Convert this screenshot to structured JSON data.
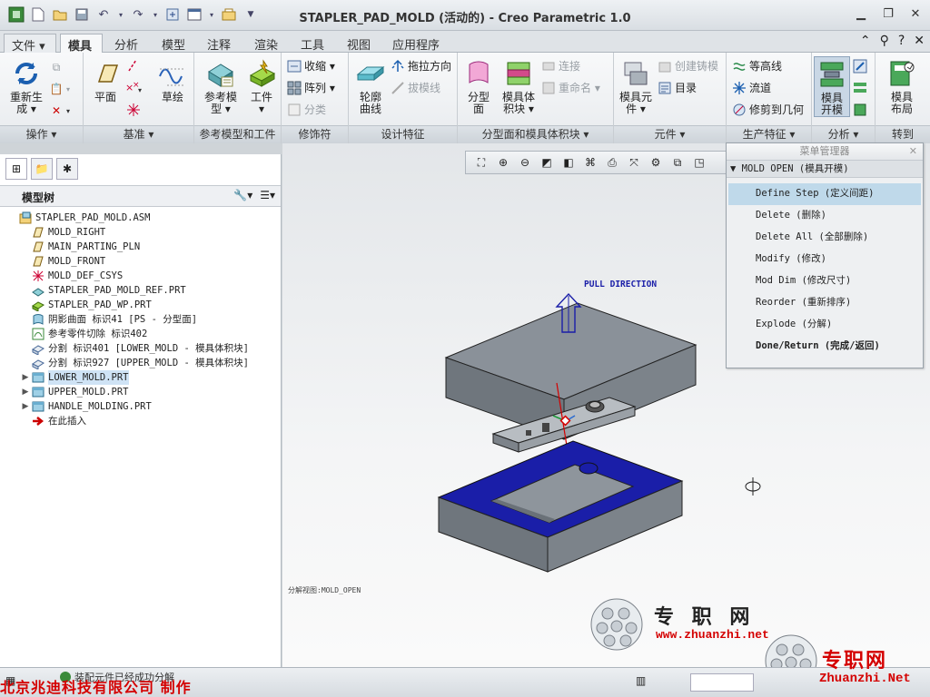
{
  "window": {
    "title": "STAPLER_PAD_MOLD (活动的) - Creo Parametric 1.0"
  },
  "tabs": [
    {
      "label": "文件 ▾"
    },
    {
      "label": "模具"
    },
    {
      "label": "分析"
    },
    {
      "label": "模型"
    },
    {
      "label": "注释"
    },
    {
      "label": "渲染"
    },
    {
      "label": "工具"
    },
    {
      "label": "视图"
    },
    {
      "label": "应用程序"
    }
  ],
  "ribbon": {
    "operations": {
      "label": "操作 ▾",
      "regen": "重新生\n成 ▾"
    },
    "datum": {
      "label": "基准 ▾",
      "plane": "平面",
      "sketch": "草绘"
    },
    "ref": {
      "label": "参考模型和工件",
      "refmodel": "参考模\n型 ▾",
      "workpiece": "工件\n▾"
    },
    "deco": {
      "label": "修饰符",
      "shrink": "收缩 ▾",
      "pattern": "阵列 ▾",
      "classify": "分类"
    },
    "design": {
      "label": "设计特征",
      "silhouette": "轮廓\n曲线",
      "pulldir": "拖拉方向",
      "draftline": "拔模线"
    },
    "parting": {
      "label": "分型面和模具体积块 ▾",
      "partingsurf": "分型\n面",
      "moldvol": "模具体\n积块 ▾",
      "connect": "连接",
      "rename": "重命名 ▾"
    },
    "component": {
      "label": "元件 ▾",
      "moldcomp": "模具元\n件 ▾",
      "createcast": "创建铸模",
      "catalog": "目录"
    },
    "production": {
      "label": "生产特征 ▾",
      "contour": "等高线",
      "runner": "流道",
      "trim": "修剪到几何"
    },
    "analysis": {
      "label": "分析 ▾",
      "moldopen": "模具\n开模"
    },
    "goto": {
      "label": "转到",
      "layout": "模具\n布局"
    }
  },
  "modeltree": {
    "title": "模型树",
    "items": [
      {
        "label": "STAPLER_PAD_MOLD.ASM",
        "icon": "assembly-icon",
        "expand": "",
        "indent": 0
      },
      {
        "label": "MOLD_RIGHT",
        "icon": "datum-plane-icon",
        "expand": "",
        "indent": 1
      },
      {
        "label": "MAIN_PARTING_PLN",
        "icon": "datum-plane-icon",
        "expand": "",
        "indent": 1
      },
      {
        "label": "MOLD_FRONT",
        "icon": "datum-plane-icon",
        "expand": "",
        "indent": 1
      },
      {
        "label": "MOLD_DEF_CSYS",
        "icon": "csys-icon",
        "expand": "",
        "indent": 1
      },
      {
        "label": "STAPLER_PAD_MOLD_REF.PRT",
        "icon": "ref-part-icon",
        "expand": "",
        "indent": 1
      },
      {
        "label": "STAPLER_PAD_WP.PRT",
        "icon": "workpiece-icon",
        "expand": "",
        "indent": 1
      },
      {
        "label": "阴影曲面 标识41 [PS - 分型面]",
        "icon": "surface-icon",
        "expand": "",
        "indent": 1
      },
      {
        "label": "参考零件切除 标识402",
        "icon": "cut-icon",
        "expand": "",
        "indent": 1
      },
      {
        "label": "分割 标识401 [LOWER_MOLD - 模具体积块]",
        "icon": "split-icon",
        "expand": "",
        "indent": 1
      },
      {
        "label": "分割 标识927 [UPPER_MOLD - 模具体积块]",
        "icon": "split-icon",
        "expand": "",
        "indent": 1
      },
      {
        "label": "LOWER_MOLD.PRT",
        "icon": "part-icon",
        "expand": "▶",
        "indent": 1,
        "selected": true
      },
      {
        "label": "UPPER_MOLD.PRT",
        "icon": "part-icon",
        "expand": "▶",
        "indent": 1
      },
      {
        "label": "HANDLE_MOLDING.PRT",
        "icon": "part-icon",
        "expand": "▶",
        "indent": 1
      },
      {
        "label": "在此插入",
        "icon": "insert-arrow-icon",
        "expand": "",
        "indent": 1
      }
    ]
  },
  "menu_manager": {
    "title": "菜单管理器",
    "submenu": "MOLD OPEN (模具开模)",
    "items": [
      {
        "label": "Define Step (定义间距)",
        "highlight": true
      },
      {
        "label": "Delete (删除)"
      },
      {
        "label": "Delete All (全部删除)"
      },
      {
        "label": "Modify (修改)"
      },
      {
        "label": "Mod Dim (修改尺寸)"
      },
      {
        "label": "Reorder (重新排序)"
      },
      {
        "label": "Explode (分解)"
      },
      {
        "label": "Done/Return (完成/返回)",
        "bold": true
      }
    ]
  },
  "graphics": {
    "pull_direction": "PULL DIRECTION",
    "view_label": "分解视图:MOLD_OPEN"
  },
  "status": {
    "message": "装配元件已经成功分解",
    "credit": "北京兆迪科技有限公司 制作"
  },
  "watermark": {
    "name1": "专 职 网",
    "url1": "www.zhuanzhi.net",
    "name2": "专职网",
    "url2": "Zhuanzhi.Net"
  },
  "colors": {
    "lower_mold": "#1a1ea8",
    "mold_gray": "#8a9199",
    "accent_red": "#d40000"
  }
}
